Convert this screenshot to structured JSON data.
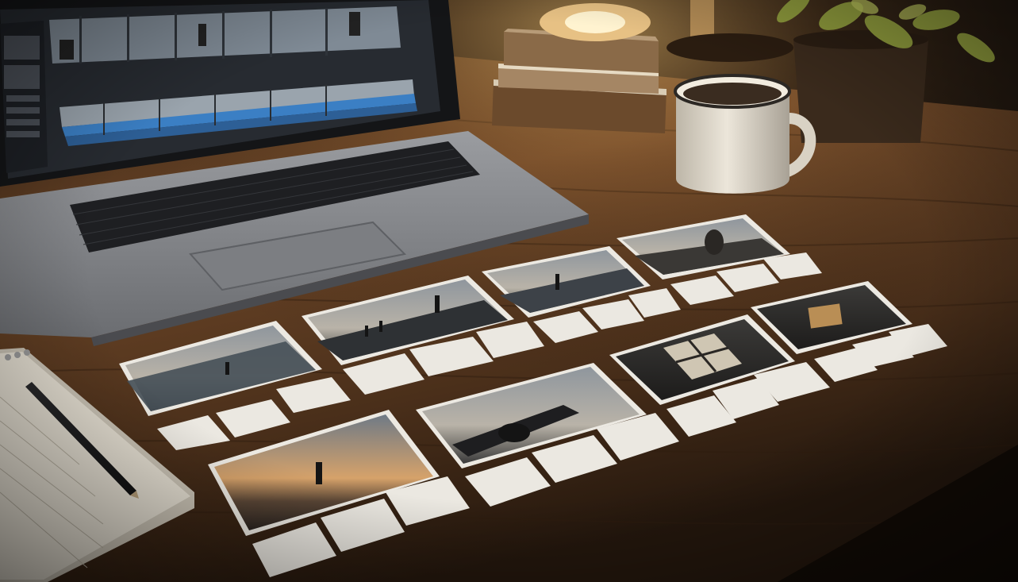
{
  "scene": {
    "palette": {
      "wall": "#1c140e",
      "desk": "#5a3b22",
      "desk_highlight": "#8a6037",
      "desk_shadow": "#24170d",
      "laptop_body": "#8b8d91",
      "laptop_dark": "#3f4043",
      "screen_bg": "#2b2f35",
      "timeline_blue": "#3b7fc4",
      "lamp_glow": "#ffd58a",
      "mug": "#e6e0d3",
      "notebook": "#e3ddd0",
      "card_white": "#ece9e2",
      "photo_sky": "#7d8690",
      "photo_dark": "#2c2a28",
      "plant": "#9aa246"
    },
    "objects": [
      "laptop",
      "video-editing-software",
      "desk-lamp",
      "book-stack",
      "coffee-mug",
      "potted-plant",
      "spiral-notebook",
      "pencil",
      "storyboard-photo-cards"
    ]
  }
}
